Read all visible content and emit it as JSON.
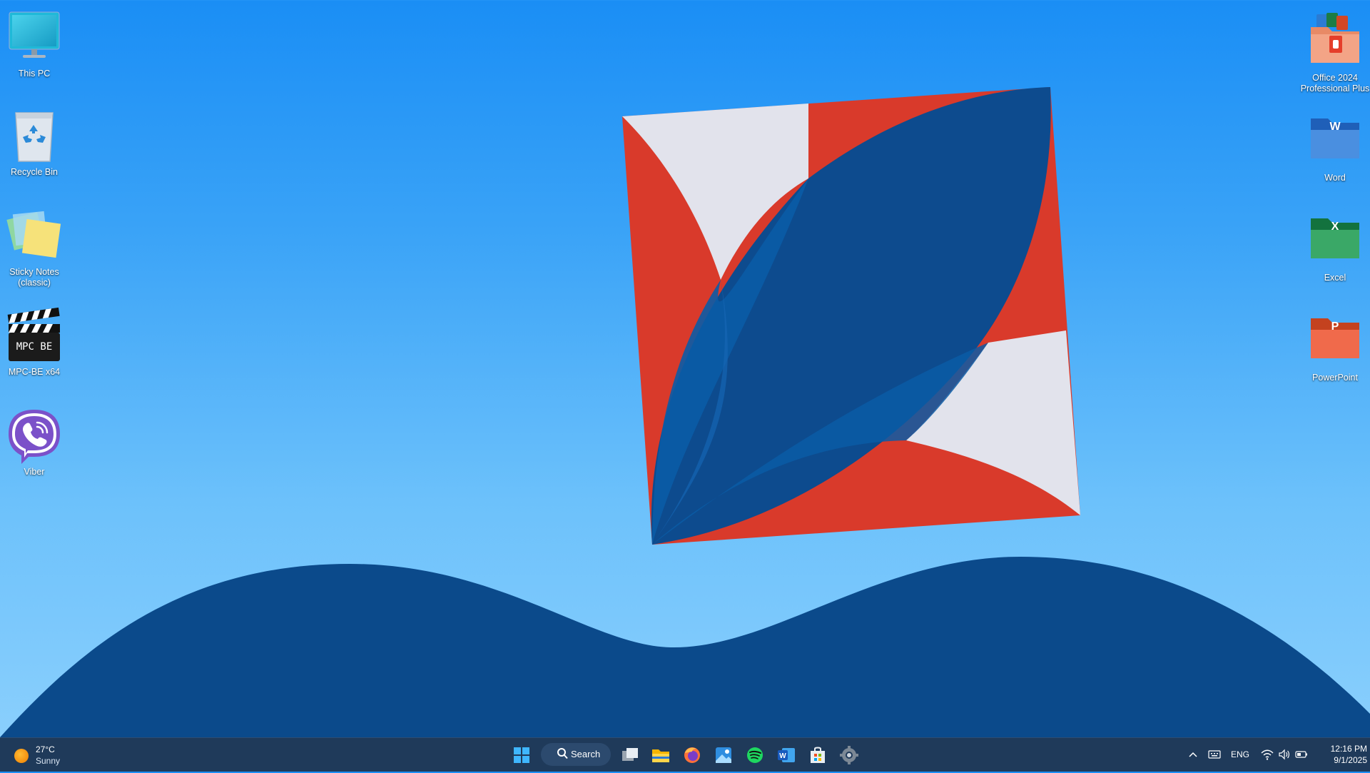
{
  "desktop": {
    "left_icons": [
      {
        "label": "This PC"
      },
      {
        "label": "Recycle Bin"
      },
      {
        "label": "Sticky Notes (classic)"
      },
      {
        "label": "MPC-BE x64"
      },
      {
        "label": "Viber"
      }
    ],
    "right_icons": [
      {
        "label": "Office 2024 Professional Plus"
      },
      {
        "label": "Word"
      },
      {
        "label": "Excel"
      },
      {
        "label": "PowerPoint"
      }
    ],
    "icon_texts": {
      "mpc": "MPC BE",
      "word": "W",
      "excel": "X",
      "ppt": "P"
    }
  },
  "taskbar": {
    "weather": {
      "temp": "27°C",
      "condition": "Sunny"
    },
    "search_label": "Search",
    "apps": [
      "start-icon",
      "task-view-icon",
      "file-explorer-icon",
      "firefox-icon",
      "photos-icon",
      "spotify-icon",
      "word-icon",
      "store-icon",
      "settings-icon"
    ],
    "tray": {
      "language": "ENG",
      "time": "12:16 PM",
      "date": "9/1/2025"
    }
  },
  "colors": {
    "wallpaper_top": "#1a8ef5",
    "wallpaper_bottom": "#8ed1fd",
    "wave": "#0b4a8b",
    "flag_red": "#d93a2b",
    "flag_white": "#e2e3ec",
    "flag_blue": "#0d4b8e",
    "taskbar": "#1f3a5a"
  }
}
